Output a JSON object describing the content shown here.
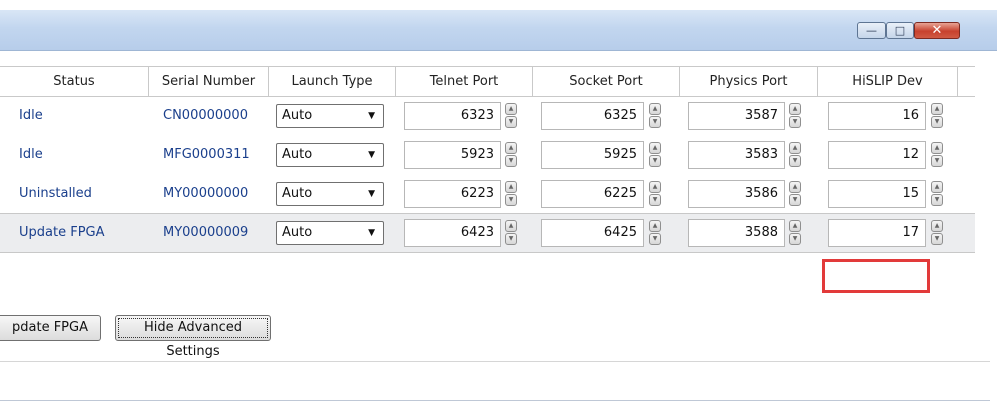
{
  "window": {
    "min_glyph": "—",
    "max_glyph": "□",
    "close_glyph": "✕"
  },
  "table": {
    "headers": [
      "Status",
      "Serial Number",
      "Launch Type",
      "Telnet Port",
      "Socket Port",
      "Physics Port",
      "HiSLIP Dev"
    ],
    "rows": [
      {
        "status": "Idle",
        "serial": "CN00000000",
        "launch": "Auto",
        "telnet": "6323",
        "socket": "6325",
        "physics": "3587",
        "hislip": "16"
      },
      {
        "status": "Idle",
        "serial": "MFG0000311",
        "launch": "Auto",
        "telnet": "5923",
        "socket": "5925",
        "physics": "3583",
        "hislip": "12"
      },
      {
        "status": "Uninstalled",
        "serial": "MY00000000",
        "launch": "Auto",
        "telnet": "6223",
        "socket": "6225",
        "physics": "3586",
        "hislip": "15"
      },
      {
        "status": "Update FPGA",
        "serial": "MY00000009",
        "launch": "Auto",
        "telnet": "6423",
        "socket": "6425",
        "physics": "3588",
        "hislip": "17"
      }
    ]
  },
  "buttons": {
    "update_fpga": "pdate FPGA",
    "hide_advanced": "Hide Advanced Settings"
  },
  "colors": {
    "link_text": "#1a3f8c",
    "highlight_box": "#e23a3a"
  }
}
